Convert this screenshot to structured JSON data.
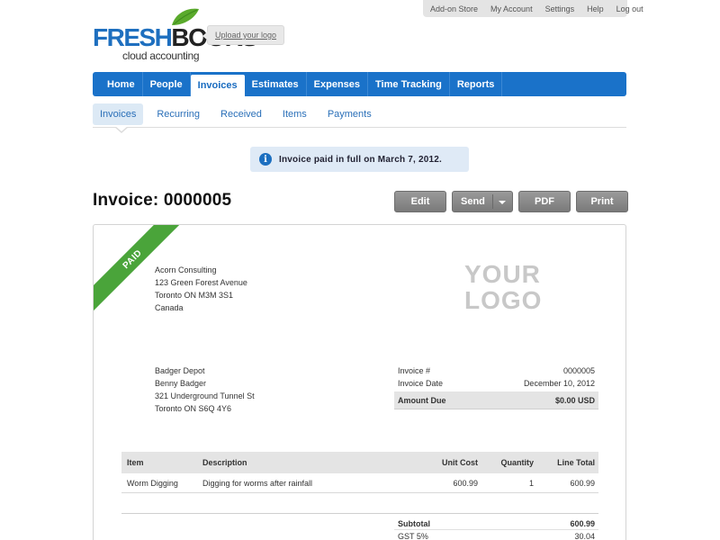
{
  "topbar": {
    "links": [
      "Add-on Store",
      "My Account",
      "Settings",
      "Help",
      "Log out"
    ]
  },
  "logo": {
    "brand_fresh": "FRESH",
    "brand_books": "BOOKS",
    "tagline": "cloud accounting",
    "upload_label": "Upload your logo"
  },
  "mainnav": {
    "tabs": [
      "Home",
      "People",
      "Invoices",
      "Estimates",
      "Expenses",
      "Time Tracking",
      "Reports"
    ],
    "active": "Invoices"
  },
  "subnav": {
    "tabs": [
      "Invoices",
      "Recurring",
      "Received",
      "Items",
      "Payments"
    ],
    "active": "Invoices"
  },
  "notice": {
    "icon": "info-icon",
    "message": "Invoice paid in full on March 7, 2012."
  },
  "invoice": {
    "title": "Invoice: 0000005",
    "actions": {
      "edit": "Edit",
      "send": "Send",
      "pdf": "PDF",
      "print": "Print"
    },
    "status_ribbon": "PAID",
    "logo_placeholder_1": "YOUR",
    "logo_placeholder_2": "LOGO",
    "from": [
      "Acorn Consulting",
      "123 Green Forest Avenue",
      "Toronto ON  M3M 3S1",
      "Canada"
    ],
    "to": [
      "Badger Depot",
      "Benny Badger",
      "321 Underground Tunnel St",
      "Toronto ON  S6Q 4Y6"
    ],
    "meta": {
      "invoice_no_label": "Invoice #",
      "invoice_no": "0000005",
      "date_label": "Invoice Date",
      "date": "December 10, 2012",
      "amount_due_label": "Amount Due",
      "amount_due": "$0.00 USD"
    },
    "items_headers": [
      "Item",
      "Description",
      "Unit Cost",
      "Quantity",
      "Line Total"
    ],
    "items": [
      {
        "item": "Worm Digging",
        "description": "Digging for worms after rainfall",
        "unit_cost": "600.99",
        "quantity": "1",
        "line_total": "600.99"
      }
    ],
    "totals": {
      "subtotal_label": "Subtotal",
      "subtotal": "600.99",
      "tax_label": "GST 5%",
      "tax": "30.04"
    }
  },
  "colors": {
    "nav_blue": "#1a72c9",
    "paid_green": "#4aa43a",
    "notice_bg": "#dfeaf6"
  }
}
